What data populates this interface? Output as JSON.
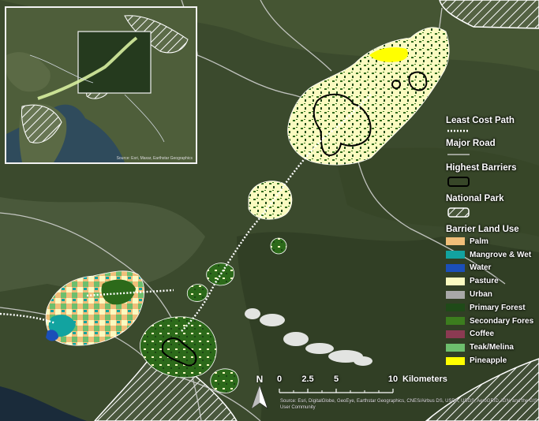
{
  "legend": {
    "least_cost_path": "Least Cost Path",
    "major_road": "Major Road",
    "highest_barriers": "Highest Barriers",
    "national_park": "National Park",
    "barrier_land_use": "Barrier Land Use",
    "land_use": [
      {
        "label": "Palm",
        "color": "#f0be79"
      },
      {
        "label": "Mangrove & Wet",
        "color": "#12a3a0"
      },
      {
        "label": "Water",
        "color": "#1b4fb8"
      },
      {
        "label": "Pasture",
        "color": "#fafac0"
      },
      {
        "label": "Urban",
        "color": "#a8a8a8"
      },
      {
        "label": "Primary Forest",
        "color": "#1f4a18"
      },
      {
        "label": "Secondary Fores",
        "color": "#3c7d1e"
      },
      {
        "label": "Coffee",
        "color": "#8b3a52"
      },
      {
        "label": "Teak/Melina",
        "color": "#6dbf6d"
      },
      {
        "label": "Pineapple",
        "color": "#ffff00"
      }
    ]
  },
  "scale": {
    "ticks": [
      "0",
      "2.5",
      "5",
      "10"
    ],
    "unit": "Kilometers"
  },
  "north_arrow": {
    "letter": "N"
  },
  "inset": {
    "credit": "Source: Esri, Maxar, Earthstar Geographics"
  },
  "credit": "Source: Esri, DigitalGlobe, GeoEye, Earthstar Geographics, CNES/Airbus DS, USDA, USGS, AeroGRID, IGN, and the GIS User Community"
}
